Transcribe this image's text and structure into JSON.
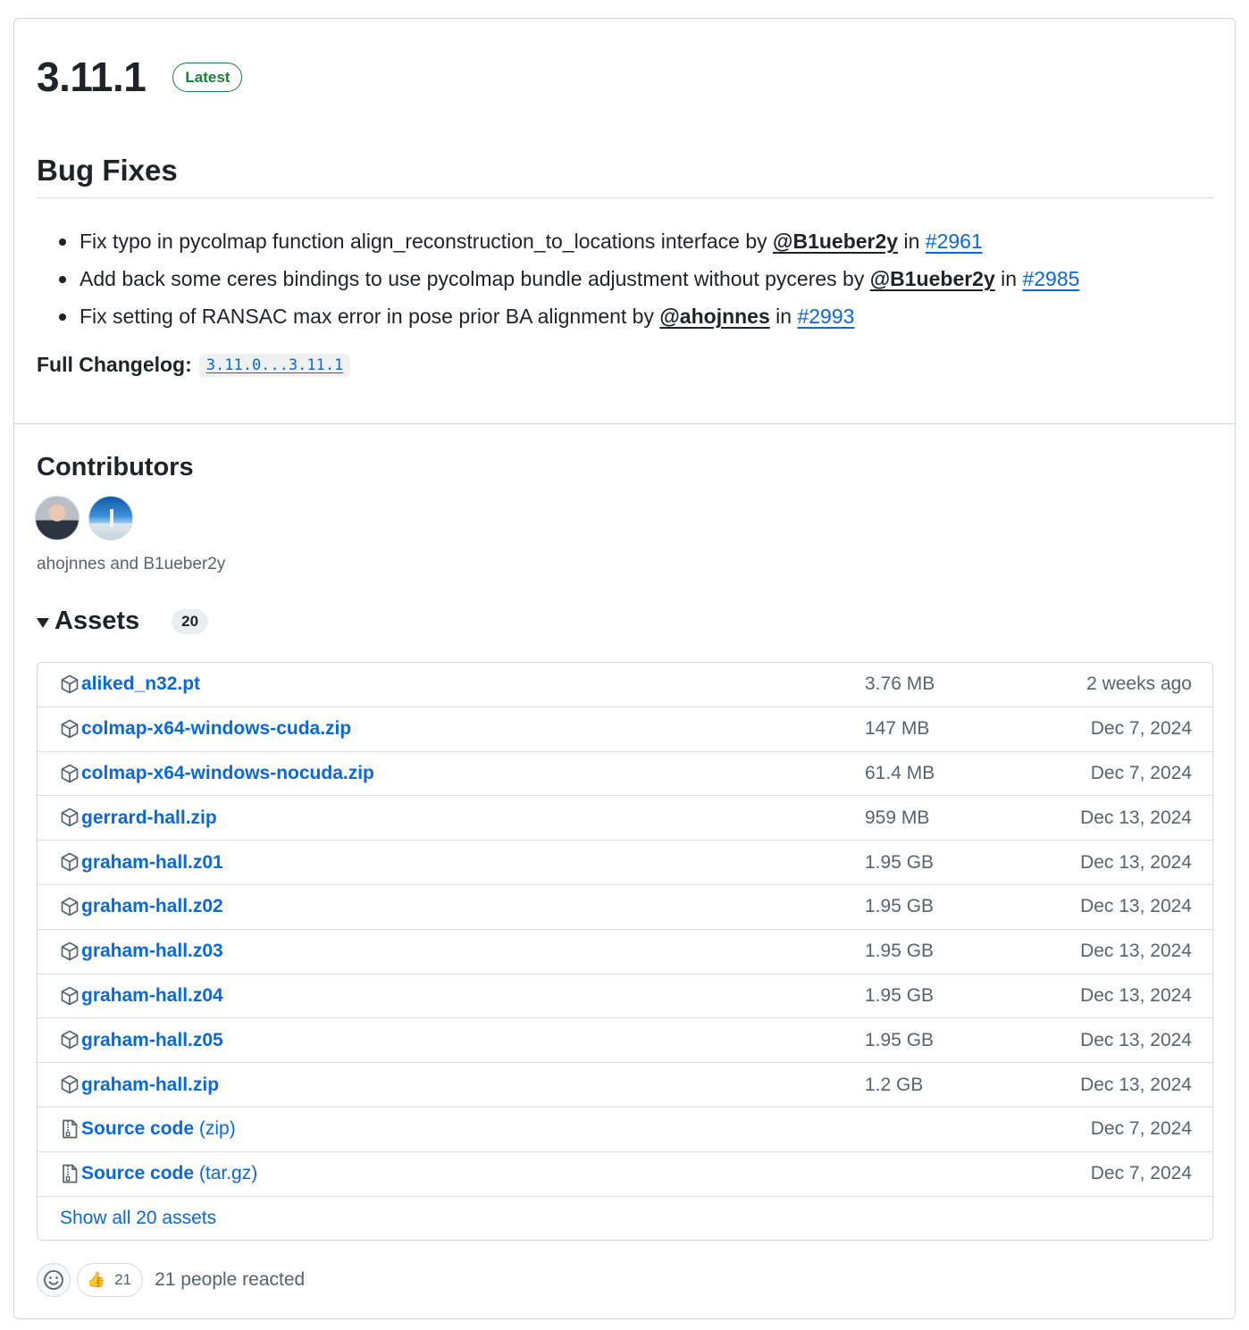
{
  "release": {
    "version": "3.11.1",
    "badge": "Latest"
  },
  "notes": {
    "heading": "Bug Fixes",
    "items": [
      {
        "text": "Fix typo in pycolmap function align_reconstruction_to_locations interface by",
        "user": "@B1ueber2y",
        "in": "in",
        "pr": "#2961"
      },
      {
        "text": "Add back some ceres bindings to use pycolmap bundle adjustment without pyceres by",
        "user": "@B1ueber2y",
        "in": "in",
        "pr": "#2985"
      },
      {
        "text": "Fix setting of RANSAC max error in pose prior BA alignment by",
        "user": "@ahojnnes",
        "in": "in",
        "pr": "#2993"
      }
    ],
    "changelog_label": "Full Changelog:",
    "changelog_ref": "3.11.0...3.11.1"
  },
  "contributors": {
    "heading": "Contributors",
    "names": "ahojnnes and B1ueber2y"
  },
  "assets": {
    "heading": "Assets",
    "count": "20",
    "rows": [
      {
        "name": "aliked_n32.pt",
        "ext": "",
        "size": "3.76 MB",
        "date": "2 weeks ago",
        "icon": "package-icon"
      },
      {
        "name": "colmap-x64-windows-cuda.zip",
        "ext": "",
        "size": "147 MB",
        "date": "Dec 7, 2024",
        "icon": "package-icon"
      },
      {
        "name": "colmap-x64-windows-nocuda.zip",
        "ext": "",
        "size": "61.4 MB",
        "date": "Dec 7, 2024",
        "icon": "package-icon"
      },
      {
        "name": "gerrard-hall.zip",
        "ext": "",
        "size": "959 MB",
        "date": "Dec 13, 2024",
        "icon": "package-icon"
      },
      {
        "name": "graham-hall.z01",
        "ext": "",
        "size": "1.95 GB",
        "date": "Dec 13, 2024",
        "icon": "package-icon"
      },
      {
        "name": "graham-hall.z02",
        "ext": "",
        "size": "1.95 GB",
        "date": "Dec 13, 2024",
        "icon": "package-icon"
      },
      {
        "name": "graham-hall.z03",
        "ext": "",
        "size": "1.95 GB",
        "date": "Dec 13, 2024",
        "icon": "package-icon"
      },
      {
        "name": "graham-hall.z04",
        "ext": "",
        "size": "1.95 GB",
        "date": "Dec 13, 2024",
        "icon": "package-icon"
      },
      {
        "name": "graham-hall.z05",
        "ext": "",
        "size": "1.95 GB",
        "date": "Dec 13, 2024",
        "icon": "package-icon"
      },
      {
        "name": "graham-hall.zip",
        "ext": "",
        "size": "1.2 GB",
        "date": "Dec 13, 2024",
        "icon": "package-icon"
      },
      {
        "name": "Source code",
        "ext": " (zip)",
        "size": "",
        "date": "Dec 7, 2024",
        "icon": "file-zip-icon"
      },
      {
        "name": "Source code",
        "ext": " (tar.gz)",
        "size": "",
        "date": "Dec 7, 2024",
        "icon": "file-zip-icon"
      }
    ],
    "show_all": "Show all 20 assets"
  },
  "reactions": {
    "emoji": "👍",
    "count": "21",
    "summary": "21 people reacted"
  }
}
